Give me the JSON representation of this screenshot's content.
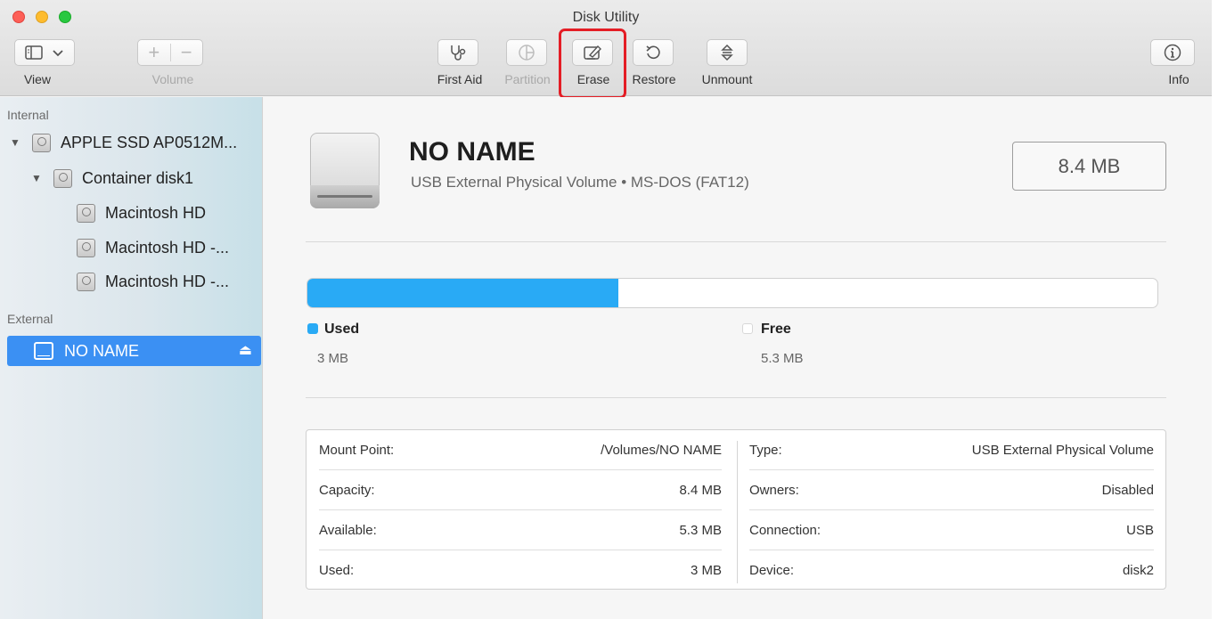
{
  "window": {
    "title": "Disk Utility"
  },
  "toolbar": {
    "view_label": "View",
    "volume_label": "Volume",
    "first_aid_label": "First Aid",
    "partition_label": "Partition",
    "erase_label": "Erase",
    "restore_label": "Restore",
    "unmount_label": "Unmount",
    "info_label": "Info",
    "highlight_color": "#e41d25"
  },
  "sidebar": {
    "internal_header": "Internal",
    "external_header": "External",
    "items": [
      {
        "label": "APPLE SSD AP0512M..."
      },
      {
        "label": "Container disk1"
      },
      {
        "label": "Macintosh HD"
      },
      {
        "label": "Macintosh HD -..."
      },
      {
        "label": "Macintosh HD -..."
      }
    ],
    "selected_item": {
      "label": "NO NAME"
    },
    "selection_color": "#3b90f3"
  },
  "volume": {
    "name": "NO NAME",
    "subtitle": "USB External Physical Volume • MS-DOS (FAT12)",
    "capacity": "8.4 MB"
  },
  "usage": {
    "used_fraction": 0.366,
    "used_color": "#29aaf5",
    "used_label": "Used",
    "used_value": "3 MB",
    "free_label": "Free",
    "free_value": "5.3 MB"
  },
  "details": {
    "left": [
      {
        "key": "Mount Point:",
        "value": "/Volumes/NO NAME"
      },
      {
        "key": "Capacity:",
        "value": "8.4 MB"
      },
      {
        "key": "Available:",
        "value": "5.3 MB"
      },
      {
        "key": "Used:",
        "value": "3 MB"
      }
    ],
    "right": [
      {
        "key": "Type:",
        "value": "USB External Physical Volume"
      },
      {
        "key": "Owners:",
        "value": "Disabled"
      },
      {
        "key": "Connection:",
        "value": "USB"
      },
      {
        "key": "Device:",
        "value": "disk2"
      }
    ]
  }
}
